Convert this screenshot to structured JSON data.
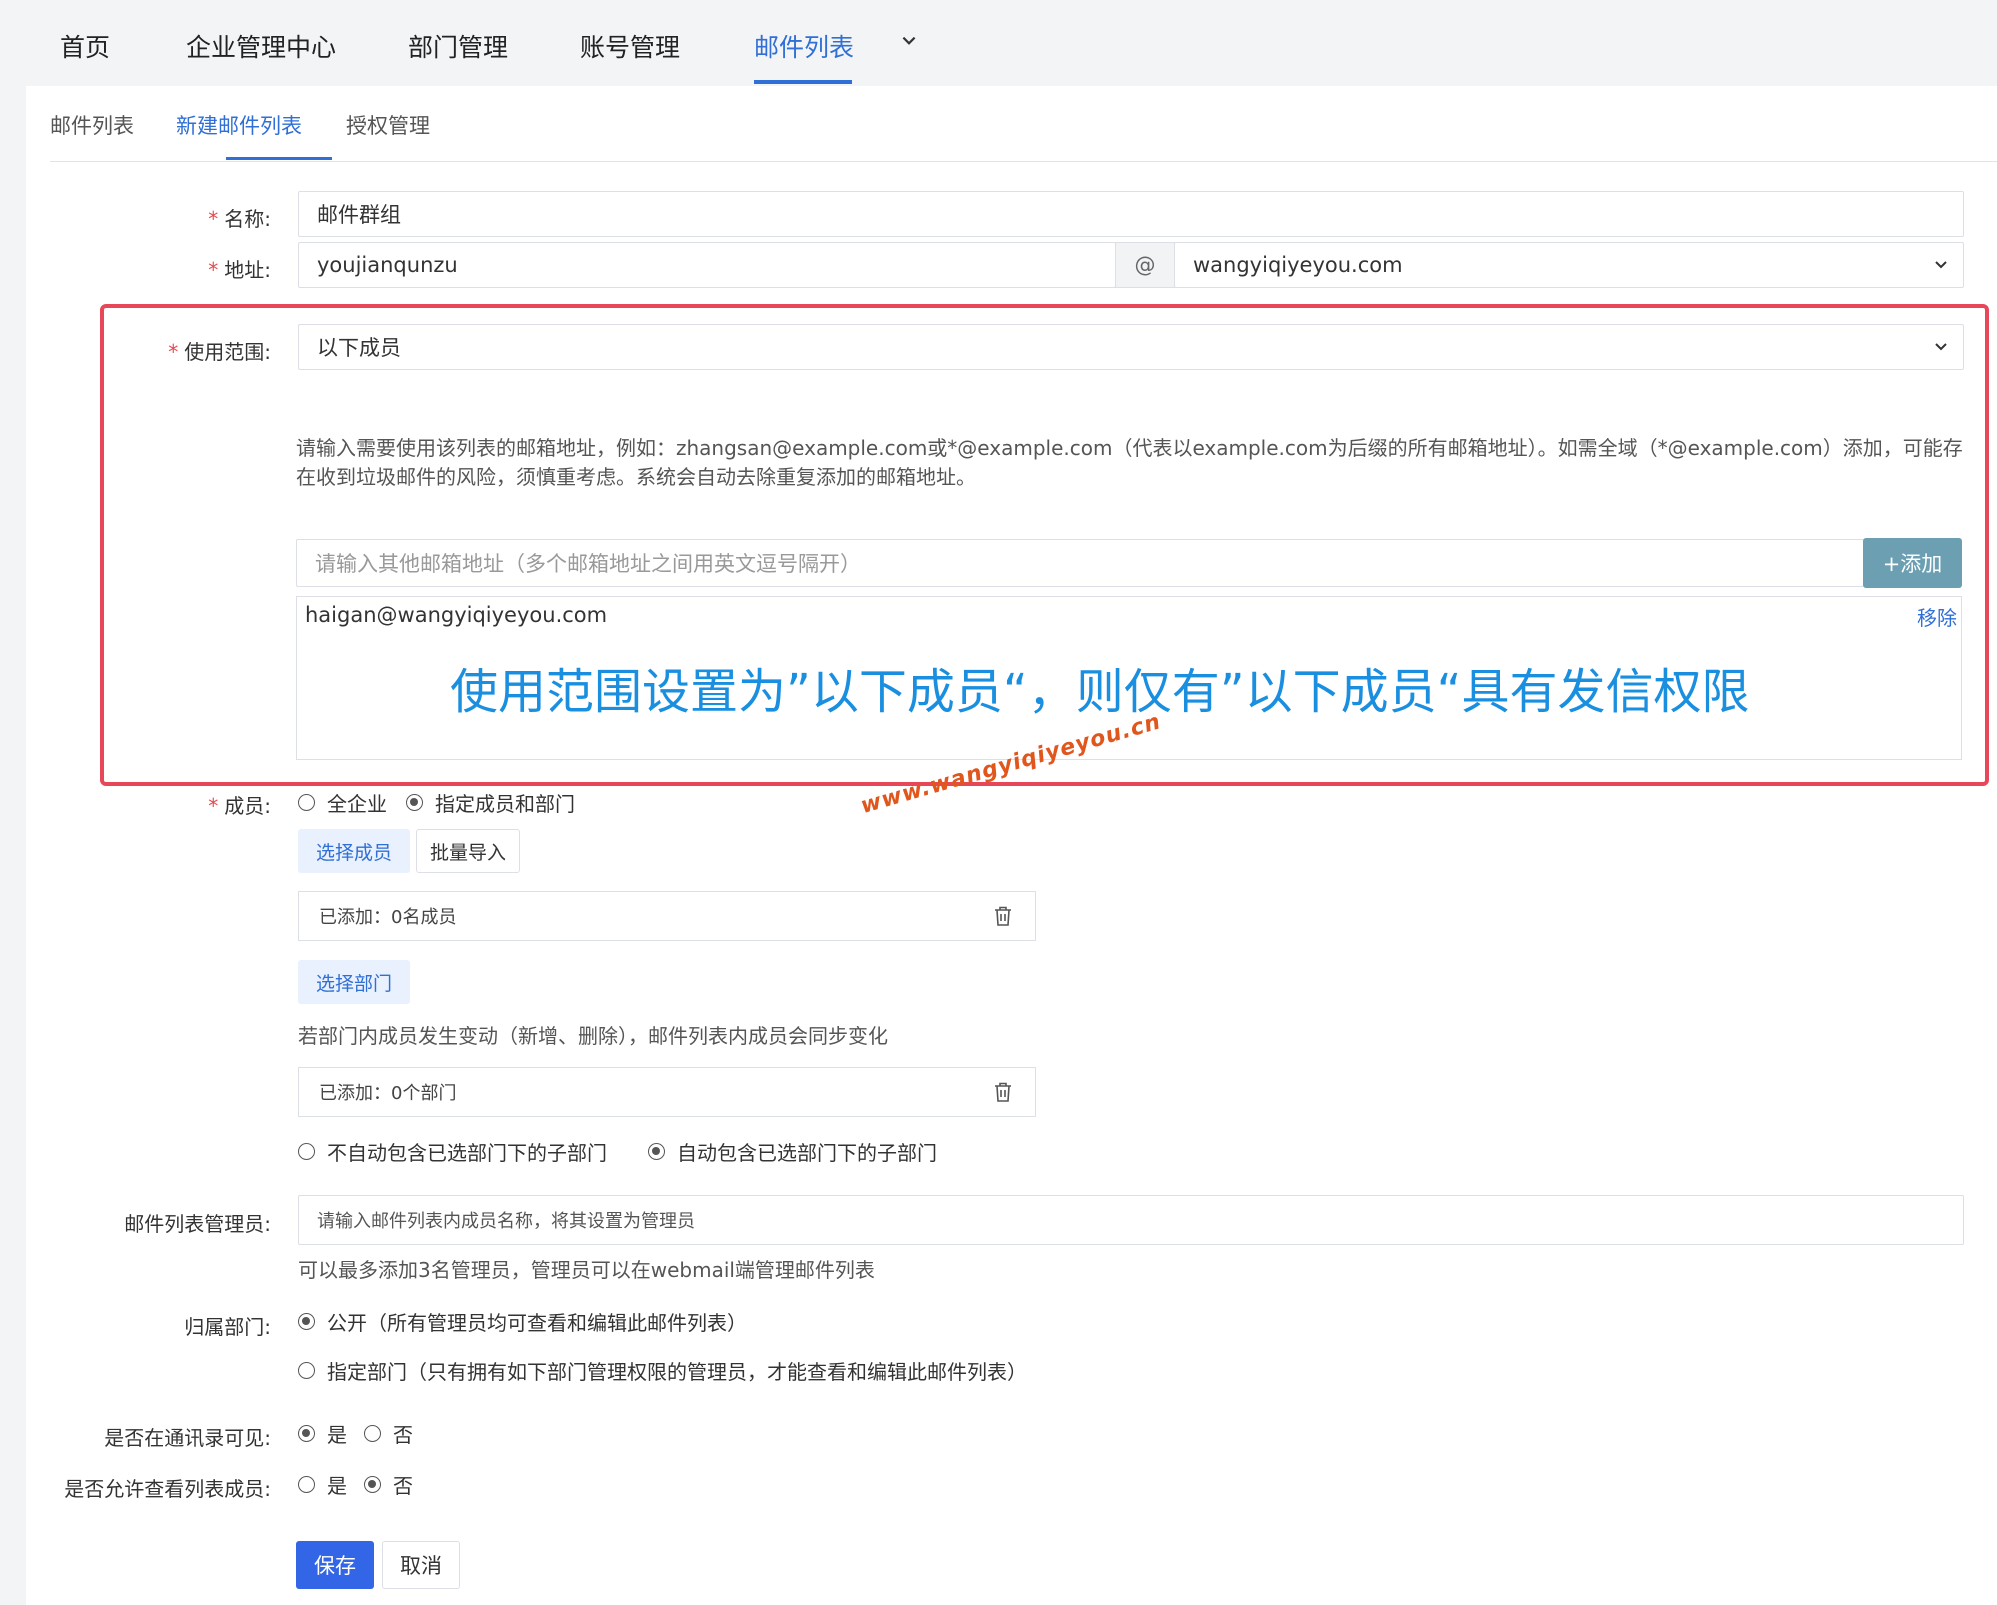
{
  "topnav": {
    "items": [
      {
        "label": "首页"
      },
      {
        "label": "企业管理中心"
      },
      {
        "label": "部门管理"
      },
      {
        "label": "账号管理"
      },
      {
        "label": "邮件列表"
      }
    ],
    "active_index": 4
  },
  "subtabs": {
    "items": [
      {
        "label": "邮件列表"
      },
      {
        "label": "新建邮件列表"
      },
      {
        "label": "授权管理"
      }
    ],
    "active_index": 1
  },
  "form": {
    "name": {
      "label": "名称:",
      "value": "邮件群组"
    },
    "address": {
      "label": "地址:",
      "local_part": "youjianqunzu",
      "at": "@",
      "domain": "wangyiqiyeyou.com"
    },
    "scope": {
      "label": "使用范围:",
      "selected": "以下成员",
      "hint": "请输入需要使用该列表的邮箱地址，例如：zhangsan@example.com或*@example.com（代表以example.com为后缀的所有邮箱地址）。如需全域（*@example.com）添加，可能存在收到垃圾邮件的风险，须慎重考虑。系统会自动去除重复添加的邮箱地址。",
      "input_placeholder": "请输入其他邮箱地址（多个邮箱地址之间用英文逗号隔开）",
      "add_button": "+添加",
      "emails": [
        "haigan@wangyiqiyeyou.com"
      ],
      "remove_label": "移除"
    },
    "members": {
      "label": "成员:",
      "options": [
        "全企业",
        "指定成员和部门"
      ],
      "selected_index": 1,
      "select_members_button": "选择成员",
      "batch_import_button": "批量导入",
      "members_added": "已添加：0名成员",
      "select_depts_button": "选择部门",
      "dept_hint": "若部门内成员发生变动（新增、删除），邮件列表内成员会同步变化",
      "depts_added": "已添加：0个部门",
      "subdept_options": [
        "不自动包含已选部门下的子部门",
        "自动包含已选部门下的子部门"
      ],
      "subdept_selected_index": 1
    },
    "admins": {
      "label": "邮件列表管理员:",
      "placeholder": "请输入邮件列表内成员名称，将其设置为管理员",
      "hint": "可以最多添加3名管理员，管理员可以在webmail端管理邮件列表"
    },
    "dept_owner": {
      "label": "归属部门:",
      "options": [
        "公开（所有管理员均可查看和编辑此邮件列表）",
        "指定部门（只有拥有如下部门管理权限的管理员，才能查看和编辑此邮件列表）"
      ],
      "selected_index": 0
    },
    "visible_in_contacts": {
      "label": "是否在通讯录可见:",
      "options": [
        "是",
        "否"
      ],
      "selected_index": 0
    },
    "allow_view_members": {
      "label": "是否允许查看列表成员:",
      "options": [
        "是",
        "否"
      ],
      "selected_index": 1
    },
    "save_button": "保存",
    "cancel_button": "取消"
  },
  "annotation": {
    "text": "使用范围设置为”以下成员“，则仅有”以下成员“具有发信权限",
    "watermark_url": "www.wangyiqiyeyou.cn",
    "box_color": "#e8475a",
    "text_color": "#1a8fe0"
  }
}
